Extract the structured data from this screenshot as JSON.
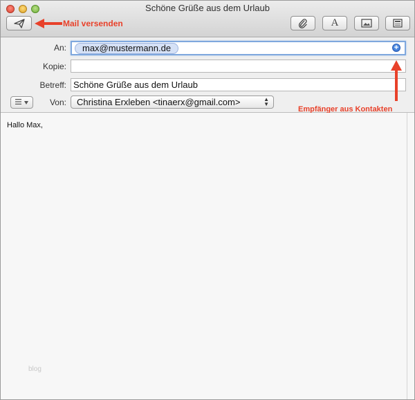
{
  "window": {
    "title": "Schöne Grüße aus dem Urlaub",
    "toolbar": {
      "send_icon": "paper-plane-icon",
      "attach_icon": "paperclip-icon",
      "fonts_icon": "font-A-icon",
      "photo_icon": "photo-browser-icon",
      "stationery_icon": "stationery-icon"
    }
  },
  "annotations": {
    "send": "Mail versenden",
    "contacts": "Empfänger aus Kontakten",
    "color": "#e8412a"
  },
  "header": {
    "to_label": "An:",
    "to_recipient": "max@mustermann.de",
    "cc_label": "Kopie:",
    "cc_value": "",
    "subject_label": "Betreff:",
    "subject_value": "Schöne Grüße aus dem Urlaub",
    "from_label": "Von:",
    "from_value": "Christina Erxleben <tinaerx@gmail.com>",
    "list_icon": "list-options-icon"
  },
  "body": {
    "text": "Hallo Max,",
    "watermark": "blog"
  }
}
